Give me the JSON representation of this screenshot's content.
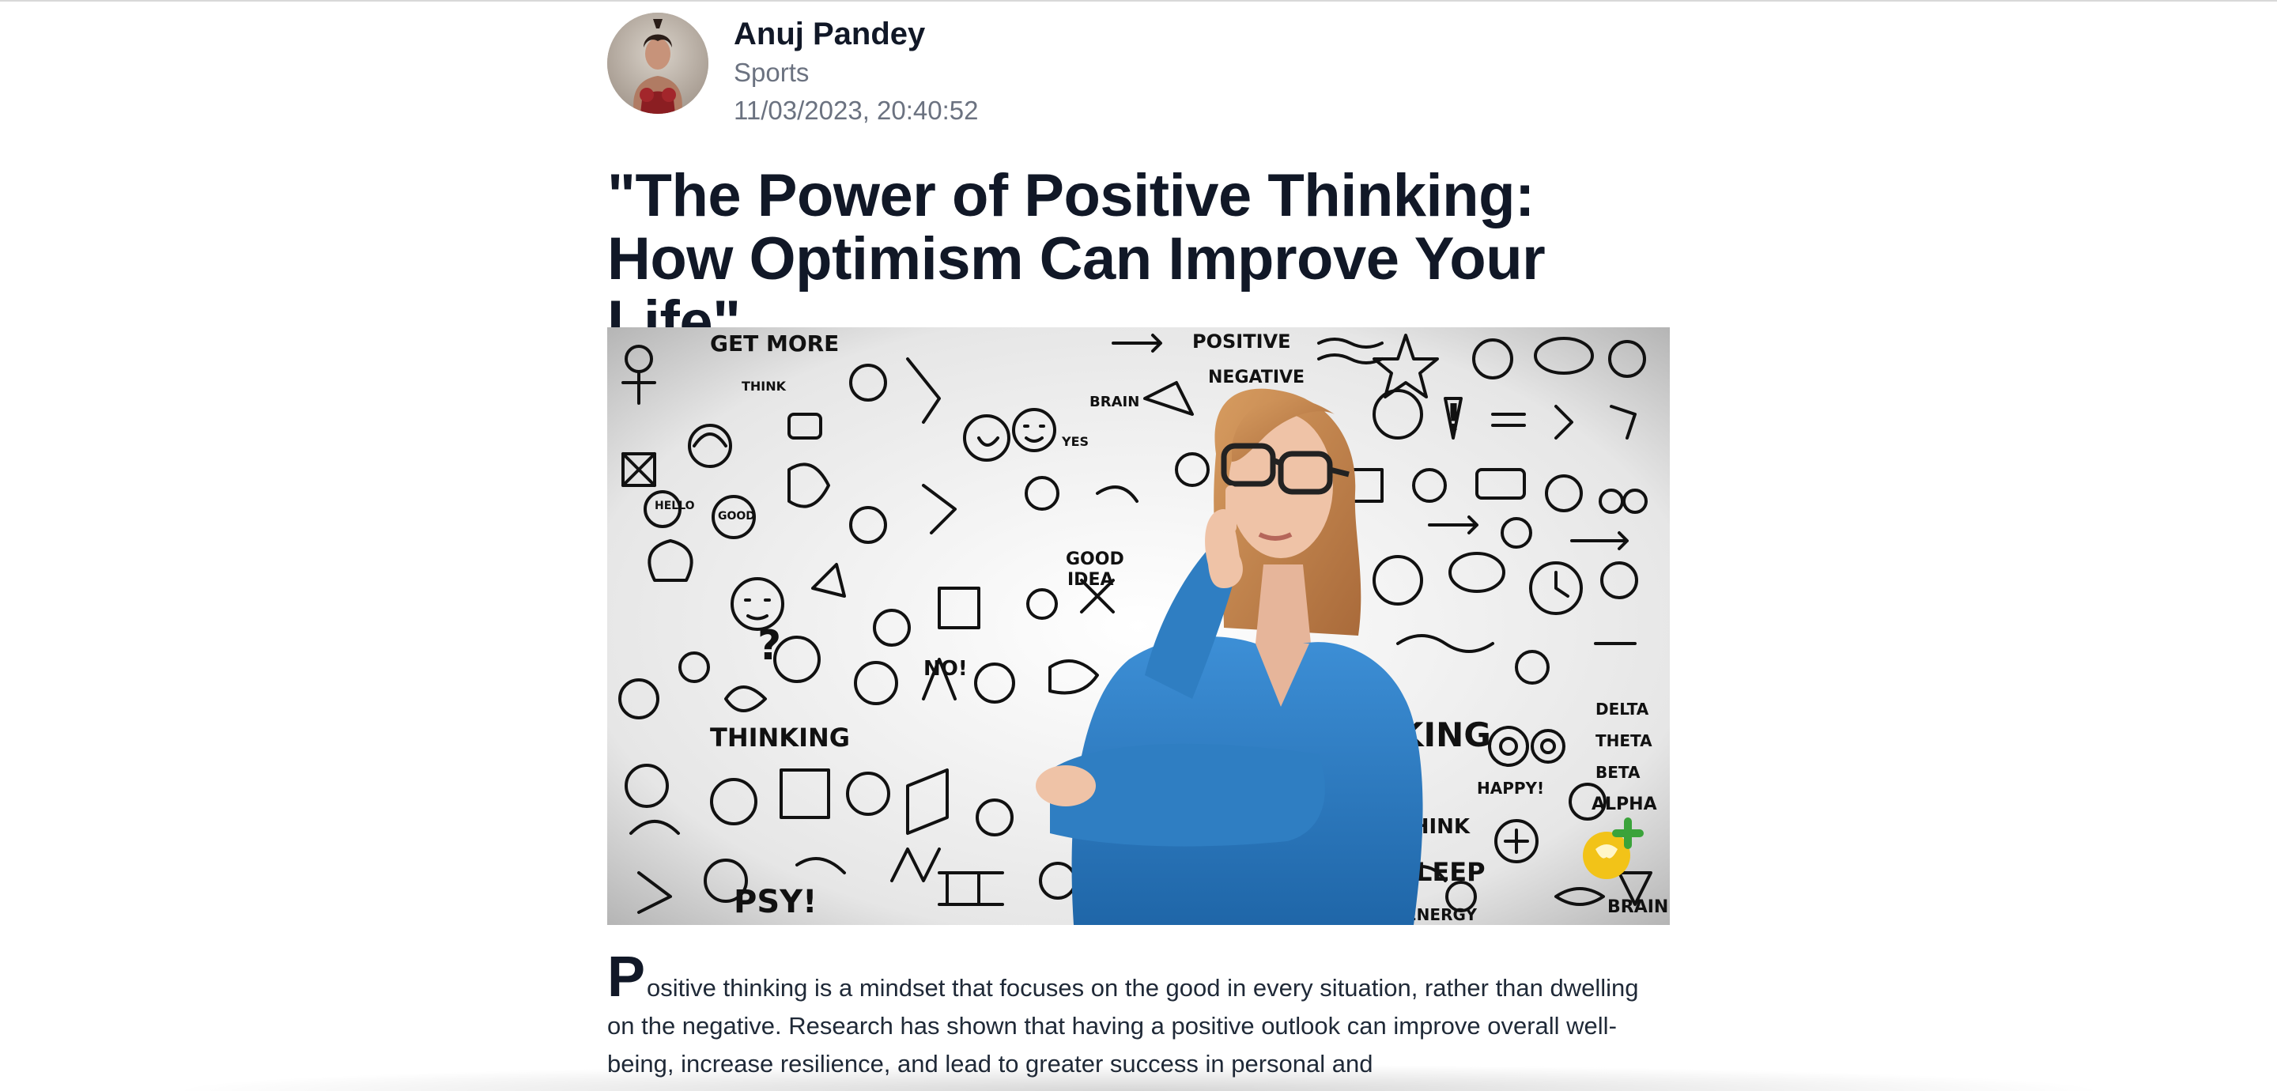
{
  "author": {
    "name": "Anuj Pandey",
    "category": "Sports",
    "timestamp": "11/03/2023, 20:40:52",
    "avatar_icon": "user-avatar-photo"
  },
  "article": {
    "title": "\"The Power of Positive Thinking: How Optimism Can Improve Your Life\"",
    "hero_image": {
      "description_icon": "thinking-woman-doodle-illustration",
      "doodle_texts": [
        "GET MORE",
        "THINK",
        "POSITIVE",
        "NEGATIVE",
        "BRAIN",
        "HELLO",
        "GOOD",
        "GOOD IDEA",
        "YES",
        "THINKING",
        "NO!",
        "PSY!",
        "HAPPY!",
        "THINK",
        "SLEEP",
        "ENERGY",
        "DELTA",
        "THETA",
        "BETA",
        "ALPHA",
        "BRAIN"
      ]
    },
    "drop_cap": "P",
    "body_first_paragraph": "ositive thinking is a mindset that focuses on the good in every situation, rather than dwelling on the negative. Research has shown that having a positive outlook can improve overall well-being, increase resilience, and lead to greater success in personal and"
  },
  "colors": {
    "heading": "#111827",
    "muted": "#6b7280",
    "body": "#1f2937",
    "sweater_blue": "#2d7fc4",
    "hair": "#c88a4f"
  }
}
